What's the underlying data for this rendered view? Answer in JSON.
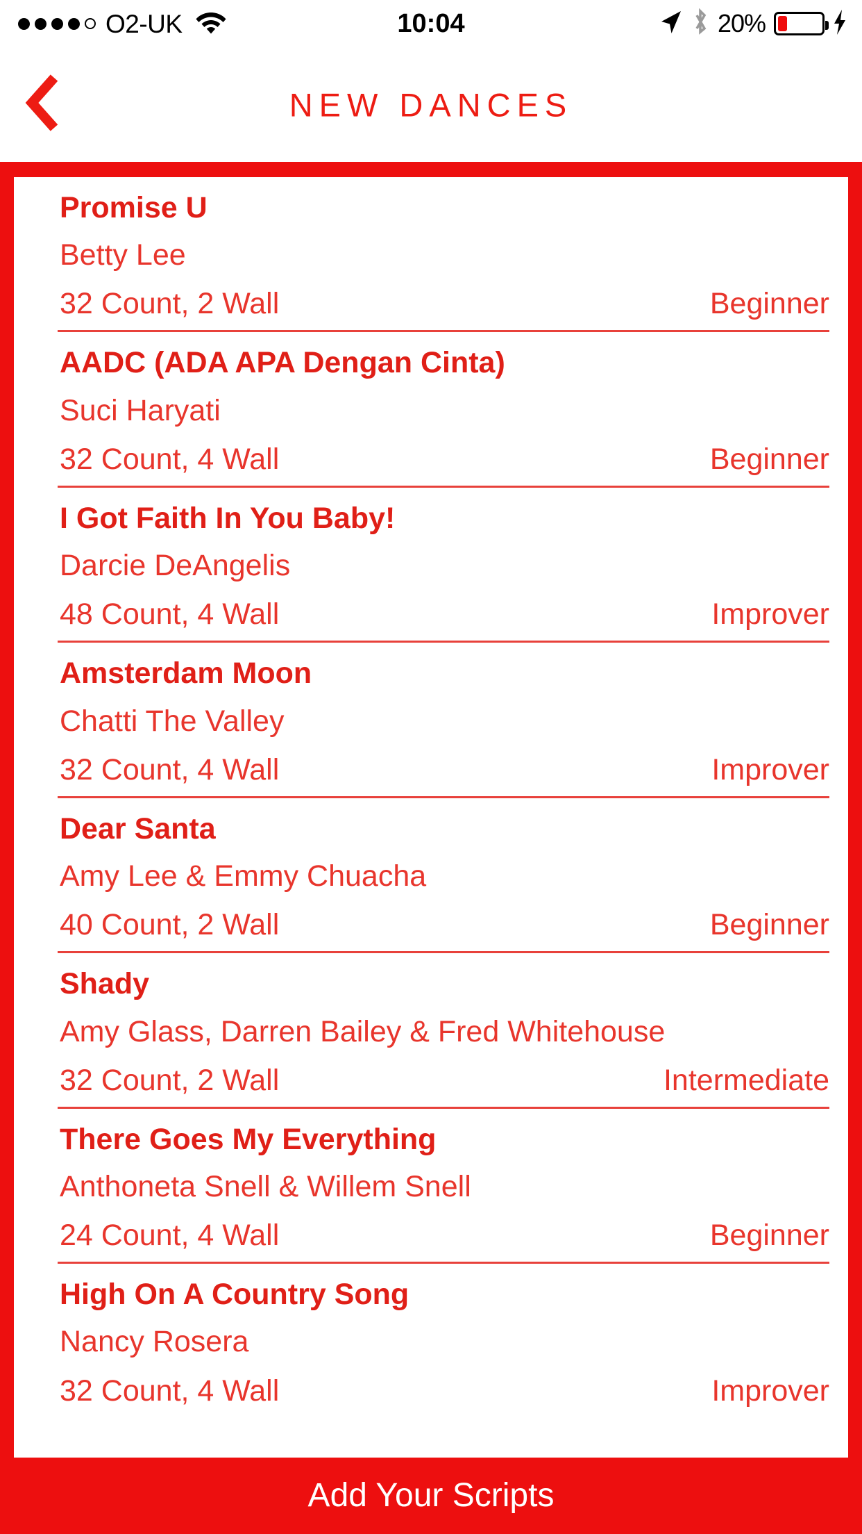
{
  "status_bar": {
    "carrier": "O2-UK",
    "signal_dots_filled": 4,
    "signal_dots_total": 5,
    "wifi_icon": "wifi-icon",
    "time": "10:04",
    "location_icon": "location-arrow-icon",
    "bluetooth_icon": "bluetooth-icon",
    "battery_percent": "20%",
    "battery_level": 20,
    "battery_color": "#ef0d0d",
    "charging_icon": "lightning-bolt-icon"
  },
  "header": {
    "back_icon": "chevron-left-icon",
    "title": "NEW DANCES",
    "accent_color": "#ed1c13"
  },
  "list": {
    "rows": [
      {
        "title": "Promise U",
        "author": "Betty Lee",
        "counts": "32 Count, 2 Wall",
        "level": "Beginner"
      },
      {
        "title": "AADC (ADA APA Dengan Cinta)",
        "author": "Suci Haryati",
        "counts": "32 Count, 4 Wall",
        "level": "Beginner"
      },
      {
        "title": "I Got Faith In You Baby!",
        "author": "Darcie DeAngelis",
        "counts": "48 Count, 4 Wall",
        "level": "Improver"
      },
      {
        "title": "Amsterdam Moon",
        "author": "Chatti The Valley",
        "counts": "32 Count, 4 Wall",
        "level": "Improver"
      },
      {
        "title": "Dear Santa",
        "author": "Amy Lee & Emmy Chuacha",
        "counts": "40 Count, 2 Wall",
        "level": "Beginner"
      },
      {
        "title": "Shady",
        "author": "Amy Glass, Darren Bailey & Fred Whitehouse",
        "counts": "32 Count, 2 Wall",
        "level": "Intermediate"
      },
      {
        "title": "There Goes My Everything",
        "author": "Anthoneta Snell & Willem Snell",
        "counts": "24 Count, 4 Wall",
        "level": "Beginner"
      },
      {
        "title": "High On A Country Song",
        "author": "Nancy Rosera",
        "counts": "32 Count, 4 Wall",
        "level": "Improver"
      }
    ]
  },
  "bottom_bar": {
    "label": "Add Your Scripts",
    "background_color": "#ed0f0f",
    "text_color": "#ffffff"
  }
}
